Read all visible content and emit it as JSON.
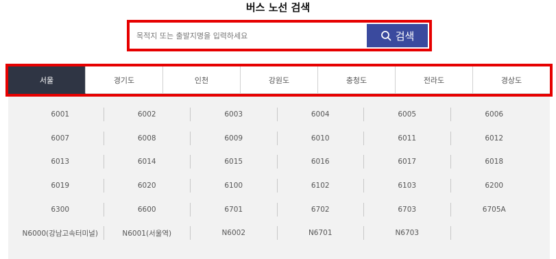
{
  "page": {
    "title": "버스 노선 검색"
  },
  "search": {
    "placeholder": "목적지 또는 출발지명을 입력하세요",
    "value": "",
    "button_label": "검색"
  },
  "tabs": [
    {
      "label": "서울",
      "active": true
    },
    {
      "label": "경기도",
      "active": false
    },
    {
      "label": "인천",
      "active": false
    },
    {
      "label": "강원도",
      "active": false
    },
    {
      "label": "충청도",
      "active": false
    },
    {
      "label": "전라도",
      "active": false
    },
    {
      "label": "경상도",
      "active": false
    }
  ],
  "routes": [
    [
      "6001",
      "6002",
      "6003",
      "6004",
      "6005",
      "6006"
    ],
    [
      "6007",
      "6008",
      "6009",
      "6010",
      "6011",
      "6012"
    ],
    [
      "6013",
      "6014",
      "6015",
      "6016",
      "6017",
      "6018"
    ],
    [
      "6019",
      "6020",
      "6100",
      "6102",
      "6103",
      "6200"
    ],
    [
      "6300",
      "6600",
      "6701",
      "6702",
      "6703",
      "6705A"
    ],
    [
      "N6000(강남고속터미널)",
      "N6001(서울역)",
      "N6002",
      "N6701",
      "N6703",
      ""
    ]
  ],
  "colors": {
    "highlight_border": "#e60000",
    "search_button": "#3a4a9e",
    "active_tab": "#2f3544",
    "panel_bg": "#f2f2f2"
  },
  "icons": {
    "search_button_icon": "search-icon"
  }
}
